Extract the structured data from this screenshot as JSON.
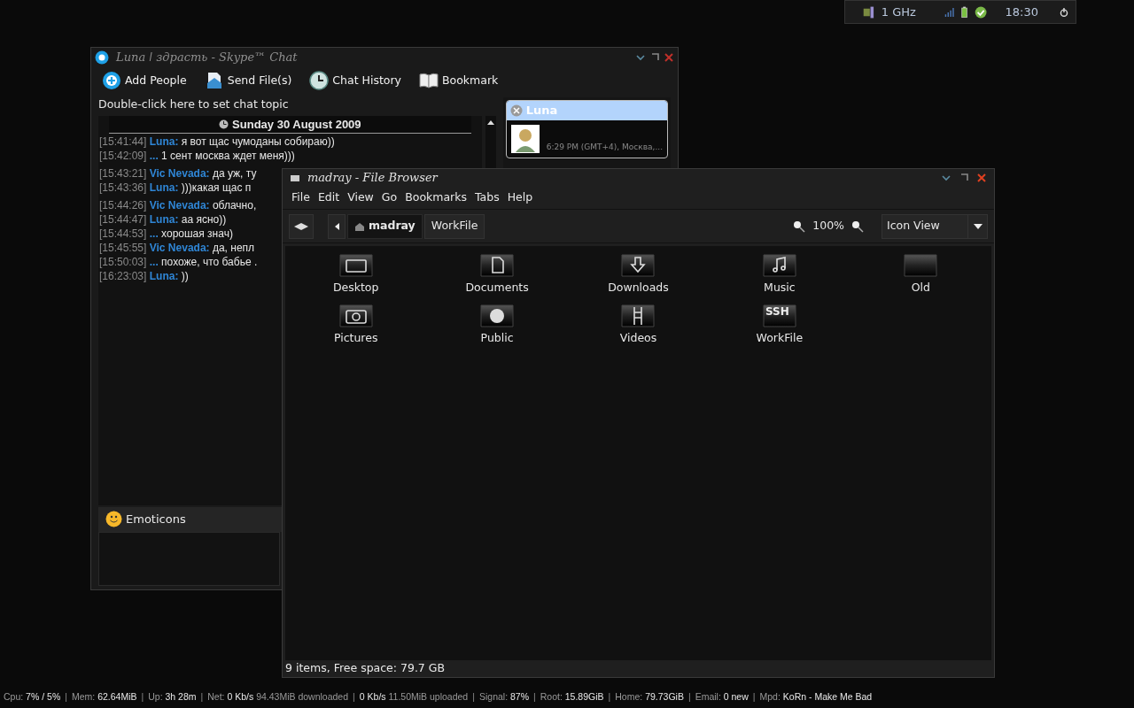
{
  "tray": {
    "cpu": "1 GHz",
    "clock": "18:30"
  },
  "chat_window": {
    "title": "Luna ǀ здрасть - Skype™ Chat",
    "toolbar": [
      {
        "kind": "add",
        "label": "Add People"
      },
      {
        "kind": "send",
        "label": "Send File(s)"
      },
      {
        "kind": "history",
        "label": "Chat History"
      },
      {
        "kind": "bookmark",
        "label": "Bookmark"
      }
    ],
    "topic": "Double-click here to set chat topic",
    "date": "Sunday 30 August 2009",
    "message_groups": [
      [
        {
          "time": "[15:41:44]",
          "sender": "Luna:",
          "text": "я вот щас чумоданы собираю))"
        },
        {
          "time": "[15:42:09]",
          "sender": "...",
          "text": "1 сент москва ждет меня)))"
        }
      ],
      [
        {
          "time": "[15:43:21]",
          "sender": "Vic Nevada:",
          "text": "да уж, ту"
        },
        {
          "time": "[15:43:36]",
          "sender": "Luna:",
          "text": ")))какая щас п"
        }
      ],
      [
        {
          "time": "[15:44:26]",
          "sender": "Vic Nevada:",
          "text": "облачно,"
        },
        {
          "time": "[15:44:47]",
          "sender": "Luna:",
          "text": "аа ясно))"
        },
        {
          "time": "[15:44:53]",
          "sender": "...",
          "text": "хорошая знач)"
        },
        {
          "time": "[15:45:55]",
          "sender": "Vic Nevada:",
          "text": "да, непл"
        },
        {
          "time": "[15:50:03]",
          "sender": "...",
          "text": "похоже, что бабье ."
        },
        {
          "time": "[16:23:03]",
          "sender": "Luna:",
          "text": "))"
        }
      ]
    ],
    "emoticons": "Emoticons",
    "contact": {
      "name": "Luna",
      "info": "6:29 PM (GMT+4), Москва,...",
      "selected": true
    }
  },
  "file_browser": {
    "title": "madray - File Browser",
    "menu": [
      "File",
      "Edit",
      "View",
      "Go",
      "Bookmarks",
      "Tabs",
      "Help"
    ],
    "path": [
      {
        "label": "madray",
        "kind": "home",
        "selected": true
      },
      {
        "label": "WorkFile",
        "kind": "folder",
        "selected": false
      }
    ],
    "zoom": "100%",
    "view": "Icon View",
    "items": [
      {
        "label": "Desktop",
        "kind": "desktop"
      },
      {
        "label": "Documents",
        "kind": "documents"
      },
      {
        "label": "Downloads",
        "kind": "downloads"
      },
      {
        "label": "Music",
        "kind": "music"
      },
      {
        "label": "Old",
        "kind": "plain"
      },
      {
        "label": "Pictures",
        "kind": "pictures"
      },
      {
        "label": "Public",
        "kind": "public"
      },
      {
        "label": "Videos",
        "kind": "videos"
      },
      {
        "label": "WorkFile",
        "kind": "ssh",
        "badge": "SSH"
      }
    ],
    "status": "9 items, Free space: 79.7 GB"
  },
  "status_bar": {
    "separator": "|",
    "segments": [
      {
        "label": "Cpu:",
        "value": "7% / 5%"
      },
      {
        "label": "Mem:",
        "value": "62.64MiB"
      },
      {
        "label": "Up:",
        "value": "3h 28m"
      },
      {
        "label": "Net:",
        "value": "0 Kb/s",
        "note": "94.43MiB downloaded"
      },
      {
        "value": "0 Kb/s",
        "note": "11.50MiB uploaded"
      },
      {
        "label": "Signal:",
        "value": "87%"
      },
      {
        "label": "Root:",
        "value": "15.89GiB"
      },
      {
        "label": "Home:",
        "value": "79.73GiB"
      },
      {
        "label": "Email:",
        "value": "0 new"
      },
      {
        "label": "Mpd:",
        "value": "KoRn - Make Me Bad"
      }
    ]
  }
}
